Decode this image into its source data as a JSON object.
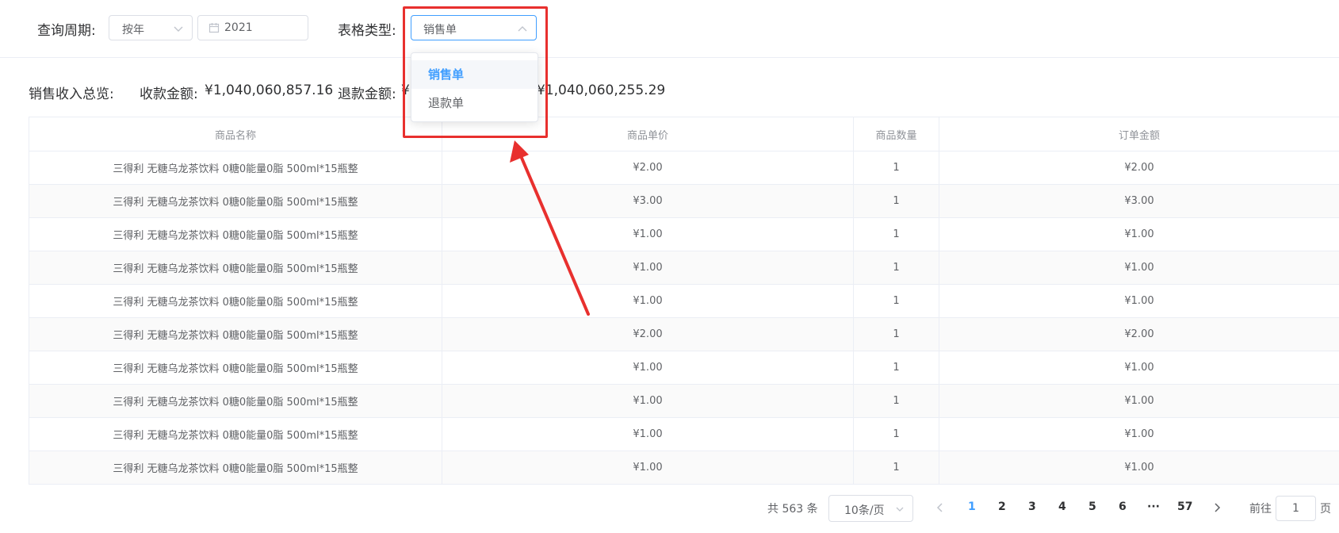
{
  "filter": {
    "period_label": "查询周期:",
    "period_mode": "按年",
    "year_value": "2021",
    "type_label": "表格类型:",
    "type_value": "销售单"
  },
  "dropdown": {
    "options": [
      "销售单",
      "退款单"
    ],
    "selected_index": 0
  },
  "summary": {
    "title": "销售收入总览:",
    "receipt_label": "收款金额:",
    "receipt_amount": "¥1,040,060,857.16",
    "refund_label": "退款金额:",
    "refund_partial": "¥",
    "net_amount": "¥1,040,060,255.29"
  },
  "table": {
    "headers": [
      "商品名称",
      "商品单价",
      "商品数量",
      "订单金额"
    ],
    "rows": [
      [
        "三得利 无糖乌龙茶饮料 0糖0能量0脂 500ml*15瓶整",
        "¥2.00",
        "1",
        "¥2.00"
      ],
      [
        "三得利 无糖乌龙茶饮料 0糖0能量0脂 500ml*15瓶整",
        "¥3.00",
        "1",
        "¥3.00"
      ],
      [
        "三得利 无糖乌龙茶饮料 0糖0能量0脂 500ml*15瓶整",
        "¥1.00",
        "1",
        "¥1.00"
      ],
      [
        "三得利 无糖乌龙茶饮料 0糖0能量0脂 500ml*15瓶整",
        "¥1.00",
        "1",
        "¥1.00"
      ],
      [
        "三得利 无糖乌龙茶饮料 0糖0能量0脂 500ml*15瓶整",
        "¥1.00",
        "1",
        "¥1.00"
      ],
      [
        "三得利 无糖乌龙茶饮料 0糖0能量0脂 500ml*15瓶整",
        "¥2.00",
        "1",
        "¥2.00"
      ],
      [
        "三得利 无糖乌龙茶饮料 0糖0能量0脂 500ml*15瓶整",
        "¥1.00",
        "1",
        "¥1.00"
      ],
      [
        "三得利 无糖乌龙茶饮料 0糖0能量0脂 500ml*15瓶整",
        "¥1.00",
        "1",
        "¥1.00"
      ],
      [
        "三得利 无糖乌龙茶饮料 0糖0能量0脂 500ml*15瓶整",
        "¥1.00",
        "1",
        "¥1.00"
      ],
      [
        "三得利 无糖乌龙茶饮料 0糖0能量0脂 500ml*15瓶整",
        "¥1.00",
        "1",
        "¥1.00"
      ]
    ]
  },
  "pagination": {
    "total": "共 563 条",
    "page_size": "10条/页",
    "pages": [
      "1",
      "2",
      "3",
      "4",
      "5",
      "6",
      "···",
      "57"
    ],
    "current_page": "1",
    "goto_label": "前往",
    "goto_value": "1",
    "page_unit": "页"
  },
  "colors": {
    "accent": "#409eff",
    "annotation": "#e8302e"
  }
}
